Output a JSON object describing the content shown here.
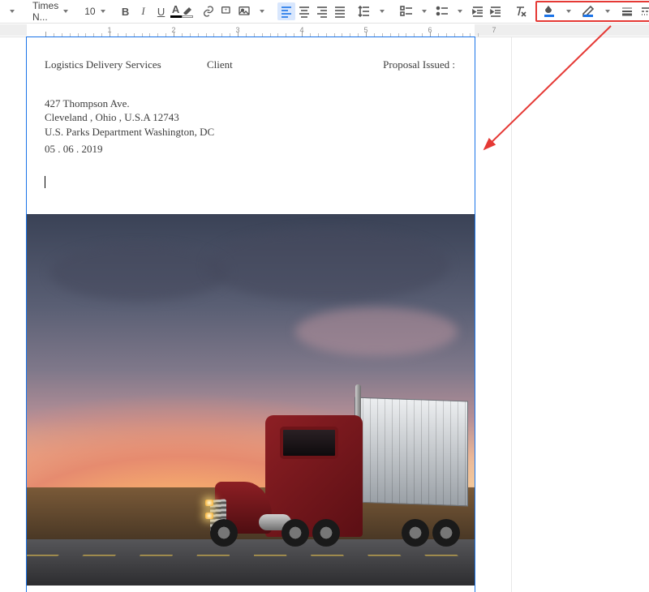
{
  "toolbar": {
    "font_name": "Times N...",
    "font_size": "10",
    "icons": {
      "style_caret": "▼",
      "bold": "B",
      "italic": "I",
      "underline": "U",
      "text_color_letter": "A"
    }
  },
  "ruler": {
    "numbers": [
      "1",
      "2",
      "3",
      "4",
      "5",
      "6",
      "7"
    ]
  },
  "document": {
    "header": {
      "col1": "Logistics Delivery Services",
      "col2": "Client",
      "col3": "Proposal Issued :"
    },
    "address": {
      "line1": "427 Thompson Ave.",
      "line2": "Cleveland , Ohio , U.S.A 12743",
      "line3": "U.S. Parks Department Washington, DC",
      "line4": "05 . 06 . 2019"
    }
  },
  "annotation": {
    "highlight_group": "cell-format-group"
  }
}
